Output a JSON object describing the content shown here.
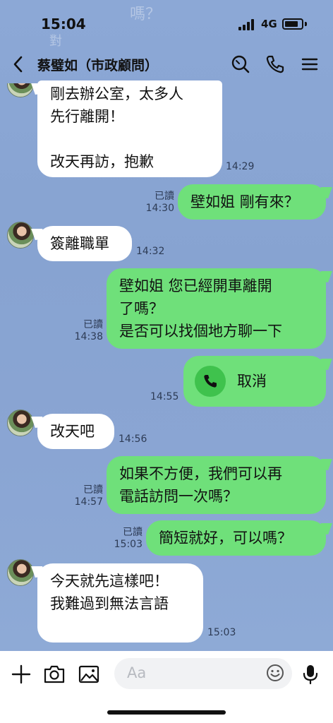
{
  "status_bar": {
    "time": "15:04",
    "network": "4G"
  },
  "background_text": {
    "a": "對",
    "b": "嗎？"
  },
  "header": {
    "contact_name": "蔡璧如（市政顧問）"
  },
  "messages": [
    {
      "text": "剛去辦公室，太多人\n先行離開！\n\n改天再訪，抱歉",
      "time": "14:29"
    },
    {
      "text": "壁如姐 剛有來？",
      "read": "已讀",
      "time": "14:30"
    },
    {
      "text": "簽離職單",
      "time": "14:32"
    },
    {
      "text": "壁如姐 您已經開車離開\n了嗎？\n是否可以找個地方聊一下",
      "read": "已讀",
      "time": "14:38"
    },
    {
      "text": "取消",
      "time": "14:55"
    },
    {
      "text": "改天吧",
      "time": "14:56"
    },
    {
      "text": "如果不方便，我們可以再\n電話訪問一次嗎？",
      "read": "已讀",
      "time": "14:57"
    },
    {
      "text": "簡短就好，可以嗎？",
      "read": "已讀",
      "time": "15:03"
    },
    {
      "text": "今天就先這樣吧！\n我難過到無法言語",
      "time": "15:03"
    }
  ],
  "input_bar": {
    "placeholder": "Aa"
  },
  "colors": {
    "chat_bg": "#8aa6d4",
    "sent_bubble": "#6fe07a",
    "received_bubble": "#ffffff",
    "call_icon_bg": "#3fc24d"
  }
}
